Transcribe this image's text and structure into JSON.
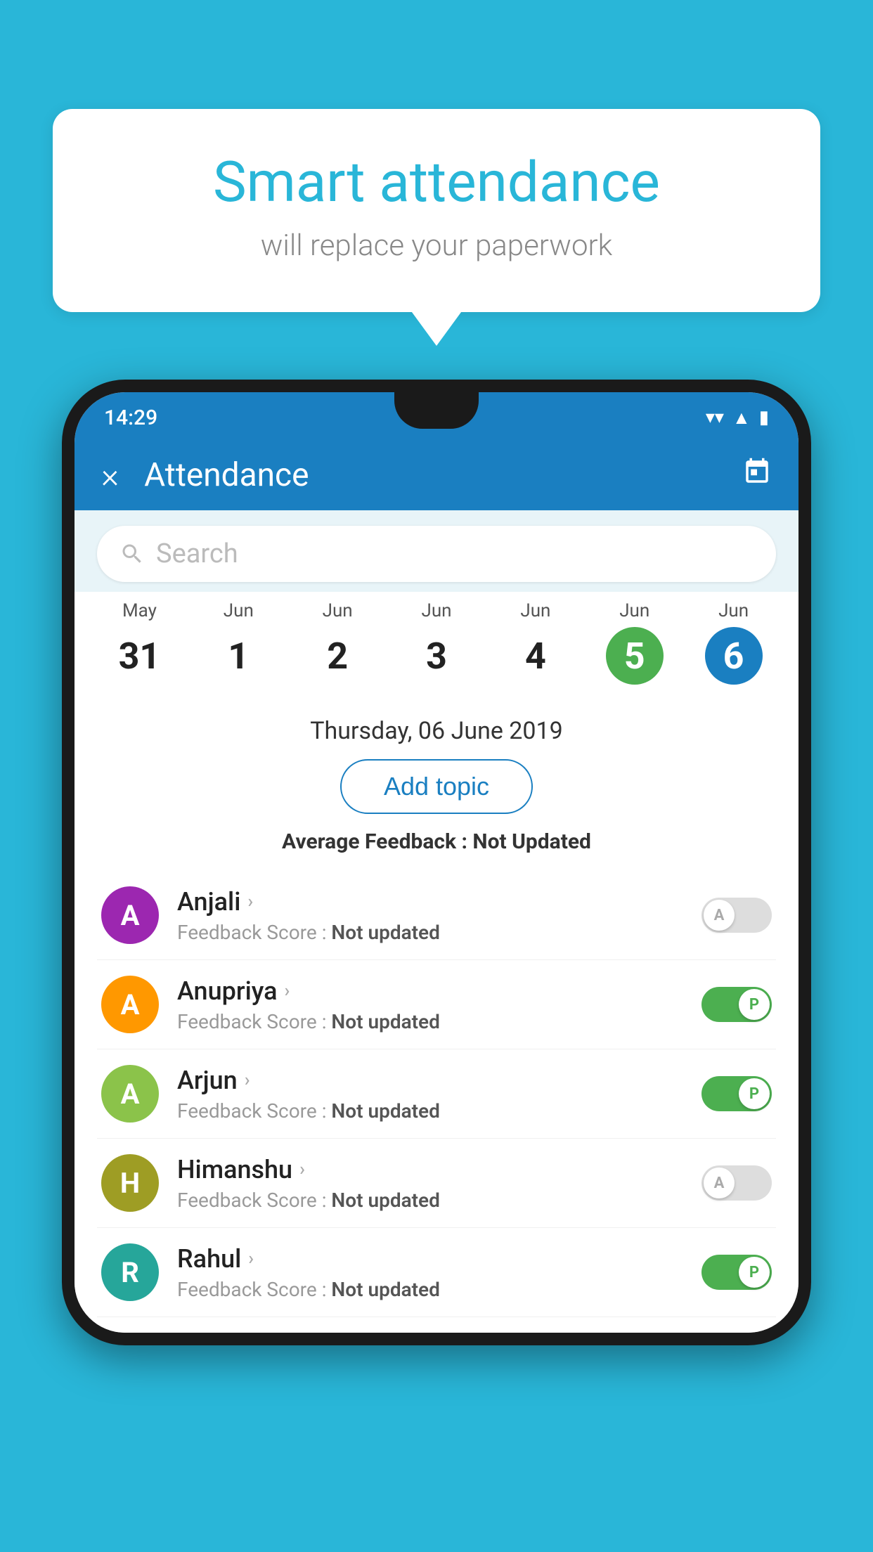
{
  "background_color": "#29B6D8",
  "speech_bubble": {
    "title": "Smart attendance",
    "subtitle": "will replace your paperwork"
  },
  "status_bar": {
    "time": "14:29",
    "wifi": "▼",
    "signal": "▲",
    "battery": "▮"
  },
  "app_bar": {
    "title": "Attendance",
    "close_label": "×",
    "calendar_label": "📅"
  },
  "search": {
    "placeholder": "Search"
  },
  "dates": [
    {
      "month": "May",
      "day": "31",
      "style": "normal"
    },
    {
      "month": "Jun",
      "day": "1",
      "style": "normal"
    },
    {
      "month": "Jun",
      "day": "2",
      "style": "normal"
    },
    {
      "month": "Jun",
      "day": "3",
      "style": "normal"
    },
    {
      "month": "Jun",
      "day": "4",
      "style": "normal"
    },
    {
      "month": "Jun",
      "day": "5",
      "style": "today"
    },
    {
      "month": "Jun",
      "day": "6",
      "style": "selected"
    }
  ],
  "selected_date_label": "Thursday, 06 June 2019",
  "add_topic_label": "Add topic",
  "avg_feedback_label": "Average Feedback :",
  "avg_feedback_value": "Not Updated",
  "students": [
    {
      "name": "Anjali",
      "feedback_label": "Feedback Score :",
      "feedback_value": "Not updated",
      "avatar_letter": "A",
      "avatar_color": "av-purple",
      "toggle_state": "off",
      "toggle_letter": "A"
    },
    {
      "name": "Anupriya",
      "feedback_label": "Feedback Score :",
      "feedback_value": "Not updated",
      "avatar_letter": "A",
      "avatar_color": "av-orange",
      "toggle_state": "on",
      "toggle_letter": "P"
    },
    {
      "name": "Arjun",
      "feedback_label": "Feedback Score :",
      "feedback_value": "Not updated",
      "avatar_letter": "A",
      "avatar_color": "av-green",
      "toggle_state": "on",
      "toggle_letter": "P"
    },
    {
      "name": "Himanshu",
      "feedback_label": "Feedback Score :",
      "feedback_value": "Not updated",
      "avatar_letter": "H",
      "avatar_color": "av-olive",
      "toggle_state": "off",
      "toggle_letter": "A"
    },
    {
      "name": "Rahul",
      "feedback_label": "Feedback Score :",
      "feedback_value": "Not updated",
      "avatar_letter": "R",
      "avatar_color": "av-teal",
      "toggle_state": "on",
      "toggle_letter": "P"
    }
  ]
}
